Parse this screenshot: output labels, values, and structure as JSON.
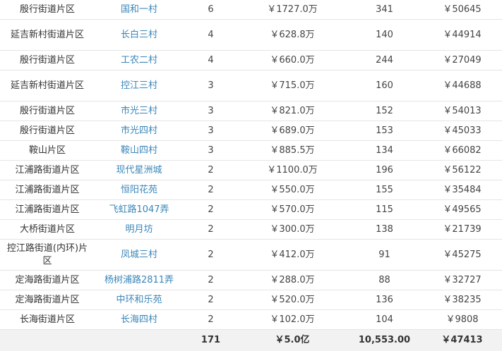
{
  "rows": [
    {
      "district": "殷行街道片区",
      "community": "国和一村",
      "count": "6",
      "total": "￥1727.0万",
      "area": "341",
      "unit_price": "￥50645"
    },
    {
      "district": "延吉新村街道片区",
      "community": "长白三村",
      "count": "4",
      "total": "￥628.8万",
      "area": "140",
      "unit_price": "￥44914"
    },
    {
      "district": "殷行街道片区",
      "community": "工农二村",
      "count": "4",
      "total": "￥660.0万",
      "area": "244",
      "unit_price": "￥27049"
    },
    {
      "district": "延吉新村街道片区",
      "community": "控江三村",
      "count": "3",
      "total": "￥715.0万",
      "area": "160",
      "unit_price": "￥44688"
    },
    {
      "district": "殷行街道片区",
      "community": "市光三村",
      "count": "3",
      "total": "￥821.0万",
      "area": "152",
      "unit_price": "￥54013"
    },
    {
      "district": "殷行街道片区",
      "community": "市光四村",
      "count": "3",
      "total": "￥689.0万",
      "area": "153",
      "unit_price": "￥45033"
    },
    {
      "district": "鞍山片区",
      "community": "鞍山四村",
      "count": "3",
      "total": "￥885.5万",
      "area": "134",
      "unit_price": "￥66082"
    },
    {
      "district": "江浦路街道片区",
      "community": "现代星洲城",
      "count": "2",
      "total": "￥1100.0万",
      "area": "196",
      "unit_price": "￥56122"
    },
    {
      "district": "江浦路街道片区",
      "community": "恒阳花苑",
      "count": "2",
      "total": "￥550.0万",
      "area": "155",
      "unit_price": "￥35484"
    },
    {
      "district": "江浦路街道片区",
      "community": "飞虹路1047弄",
      "count": "2",
      "total": "￥570.0万",
      "area": "115",
      "unit_price": "￥49565"
    },
    {
      "district": "大桥街道片区",
      "community": "明月坊",
      "count": "2",
      "total": "￥300.0万",
      "area": "138",
      "unit_price": "￥21739"
    },
    {
      "district": "控江路街道(内环)片区",
      "community": "凤城三村",
      "count": "2",
      "total": "￥412.0万",
      "area": "91",
      "unit_price": "￥45275"
    },
    {
      "district": "定海路街道片区",
      "community": "杨树浦路2811弄",
      "count": "2",
      "total": "￥288.0万",
      "area": "88",
      "unit_price": "￥32727"
    },
    {
      "district": "定海路街道片区",
      "community": "中环和乐苑",
      "count": "2",
      "total": "￥520.0万",
      "area": "136",
      "unit_price": "￥38235"
    },
    {
      "district": "长海街道片区",
      "community": "长海四村",
      "count": "2",
      "total": "￥102.0万",
      "area": "104",
      "unit_price": "￥9808"
    }
  ],
  "totals": {
    "district": "",
    "community": "",
    "count": "171",
    "total": "￥5.0亿",
    "area": "10,553.00",
    "unit_price": "￥47413"
  },
  "colors": {
    "link": "#3a86b8",
    "total_row_bg": "#f2f2f2",
    "border": "#e5e5e5"
  }
}
